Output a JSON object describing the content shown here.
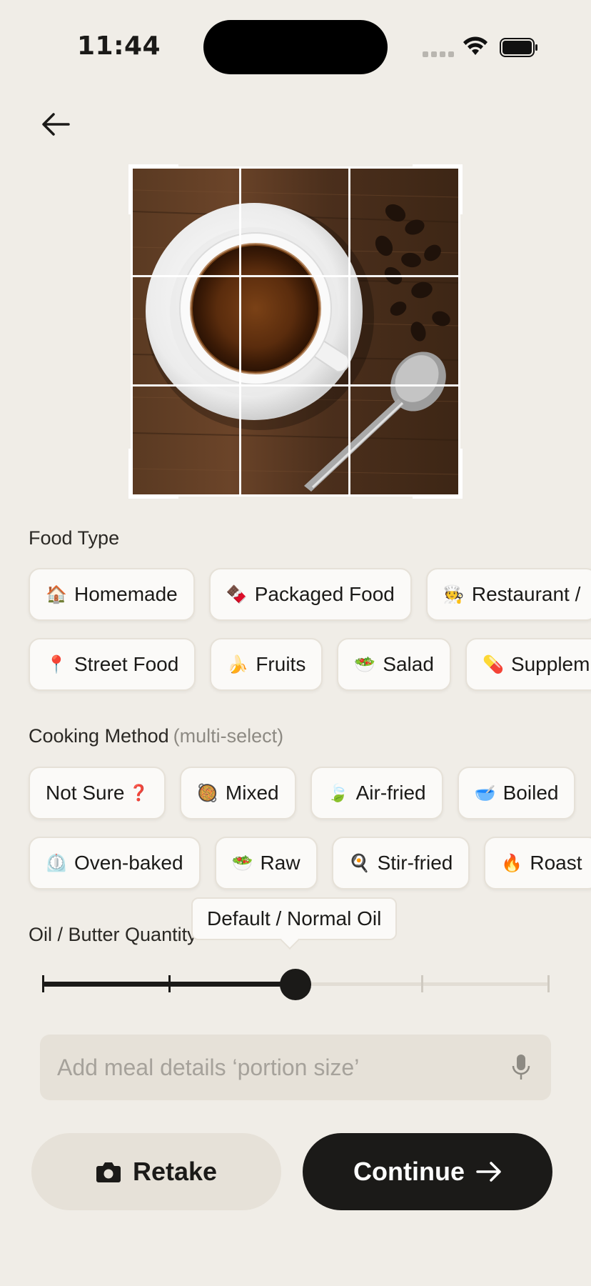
{
  "status_bar": {
    "time": "11:44"
  },
  "food_type": {
    "label": "Food Type",
    "row1": [
      {
        "emoji": "🏠",
        "label": "Homemade"
      },
      {
        "emoji": "🍫",
        "label": "Packaged Food"
      },
      {
        "emoji": "🧑‍🍳",
        "label": "Restaurant /"
      }
    ],
    "row2": [
      {
        "emoji": "📍",
        "label": "Street Food"
      },
      {
        "emoji": "🍌",
        "label": "Fruits"
      },
      {
        "emoji": "🥗",
        "label": "Salad"
      },
      {
        "emoji": "💊",
        "label": "Supplem"
      }
    ]
  },
  "cooking_method": {
    "label": "Cooking Method",
    "hint": "(multi-select)",
    "row1": [
      {
        "emoji": "",
        "label": "Not Sure",
        "suffix": "❓"
      },
      {
        "emoji": "🥘",
        "label": "Mixed"
      },
      {
        "emoji": "🍃",
        "label": "Air-fried"
      },
      {
        "emoji": "🥣",
        "label": "Boiled"
      }
    ],
    "row2": [
      {
        "emoji": "⏲️",
        "label": "Oven-baked"
      },
      {
        "emoji": "🥗",
        "label": "Raw"
      },
      {
        "emoji": "🍳",
        "label": "Stir-fried"
      },
      {
        "emoji": "🔥",
        "label": "Roast"
      }
    ]
  },
  "oil": {
    "label": "Oil / Butter Quantity",
    "tooltip": "Default / Normal Oil",
    "steps": 5,
    "selected_index": 2
  },
  "details": {
    "placeholder": "Add meal details ‘portion size’",
    "value": ""
  },
  "buttons": {
    "retake": "Retake",
    "continue": "Continue"
  },
  "colors": {
    "background": "#f0ede7",
    "primary": "#1b1a18",
    "chip_bg": "#fbfaf8",
    "input_bg": "#e6e1d8"
  },
  "icons": {
    "back": "arrow-left-icon",
    "camera": "camera-icon",
    "mic": "microphone-icon",
    "continue": "arrow-right-icon"
  }
}
